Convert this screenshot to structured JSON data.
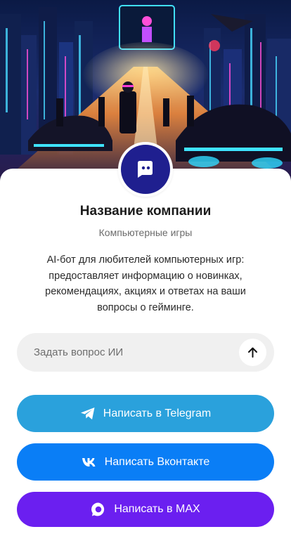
{
  "company": {
    "name": "Название компании",
    "category": "Компьютерные игры",
    "description": "AI-бот для любителей компьютерных игр: предоставляет информацию о новинках, рекомендациях, акциях и ответах на ваши вопросы о гейминге."
  },
  "ask": {
    "placeholder": "Задать вопрос ИИ",
    "send_icon": "arrow-up-icon"
  },
  "buttons": {
    "telegram": {
      "label": "Написать в Telegram",
      "icon": "telegram-icon",
      "color": "#2aa1dc"
    },
    "vk": {
      "label": "Написать Вконтакте",
      "icon": "vk-icon",
      "color": "#0a7ef6"
    },
    "max": {
      "label": "Написать в MAX",
      "icon": "max-icon",
      "color": "#6b1ff0"
    }
  },
  "avatar": {
    "icon": "chat-bot-icon",
    "color": "#1f1f8f"
  }
}
